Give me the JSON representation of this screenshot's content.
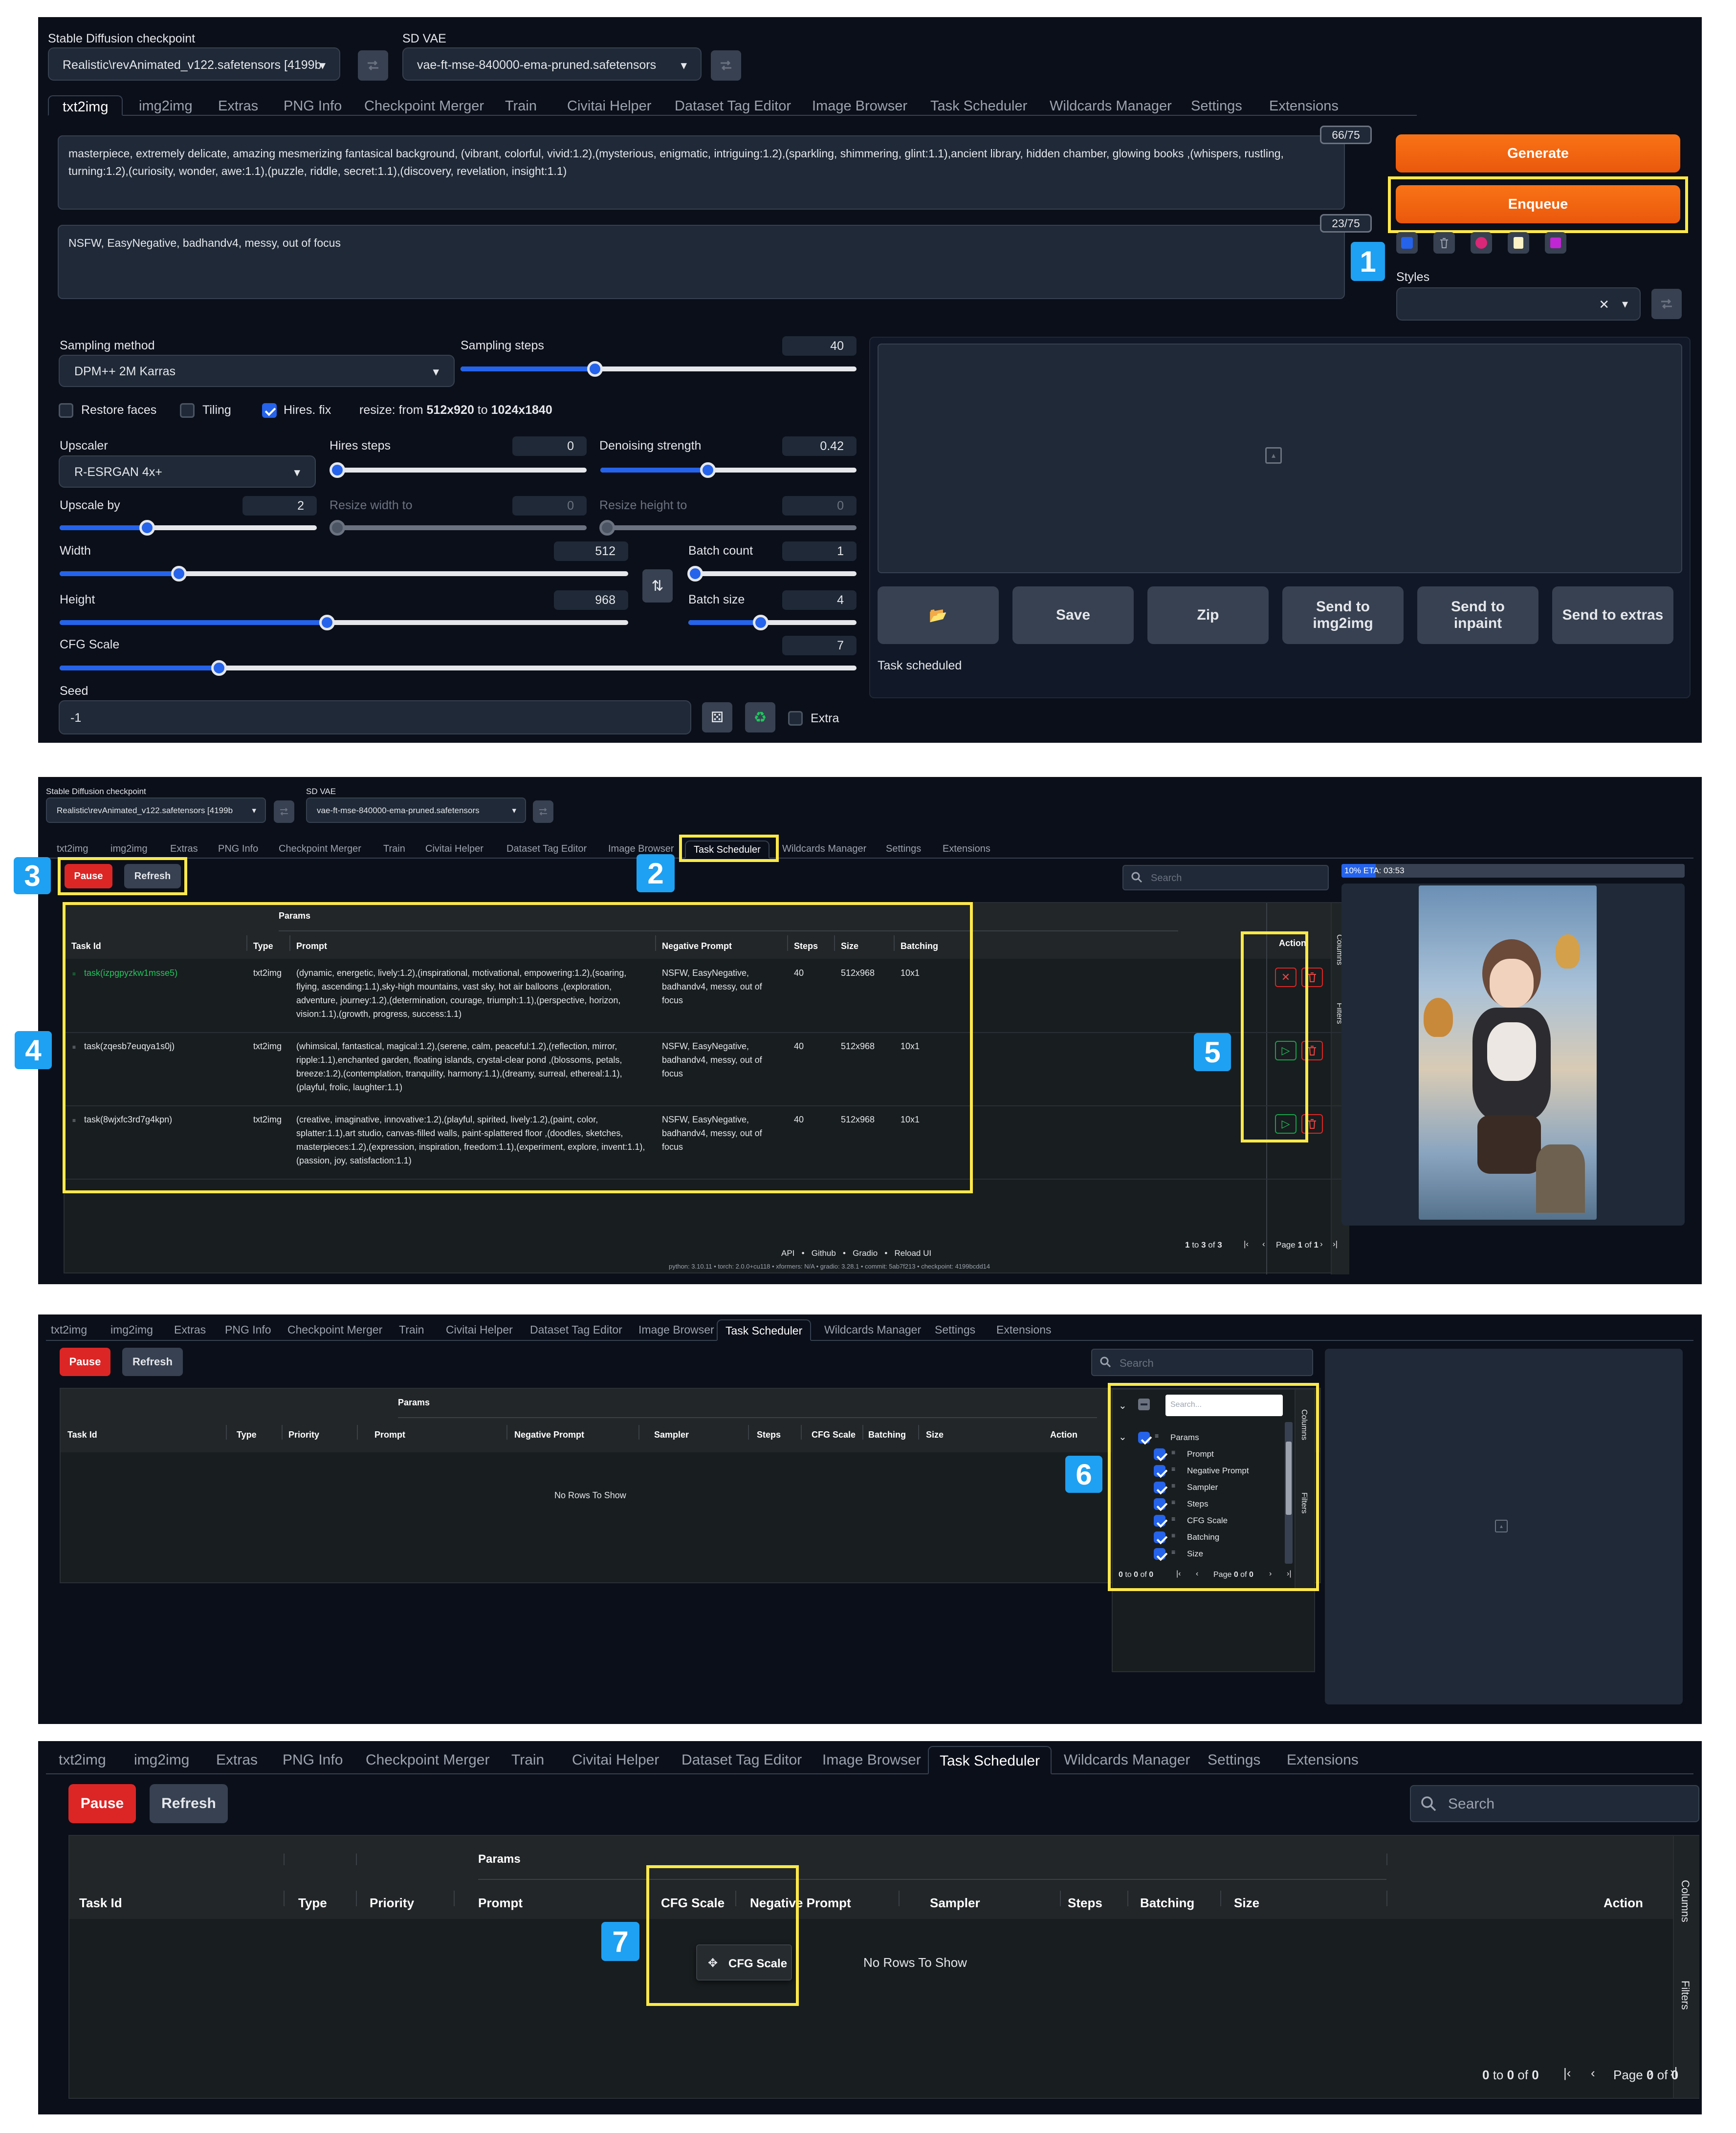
{
  "p1": {
    "ckpt_label": "Stable Diffusion checkpoint",
    "ckpt_value": "Realistic\\revAnimated_v122.safetensors [4199b",
    "vae_label": "SD VAE",
    "vae_value": "vae-ft-mse-840000-ema-pruned.safetensors",
    "tabs": [
      "txt2img",
      "img2img",
      "Extras",
      "PNG Info",
      "Checkpoint Merger",
      "Train",
      "Civitai Helper",
      "Dataset Tag Editor",
      "Image Browser",
      "Task Scheduler",
      "Wildcards Manager",
      "Settings",
      "Extensions"
    ],
    "prompt": "masterpiece, extremely delicate, amazing mesmerizing fantasical background, (vibrant, colorful, vivid:1.2),(mysterious, enigmatic, intriguing:1.2),(sparkling, shimmering, glint:1.1),ancient library, hidden chamber, glowing books ,(whispers, rustling, turning:1.2),(curiosity, wonder, awe:1.1),(puzzle, riddle, secret:1.1),(discovery, revelation, insight:1.1)",
    "prompt_count": "66/75",
    "neg_prompt": "NSFW, EasyNegative, badhandv4, messy, out of focus",
    "neg_count": "23/75",
    "generate": "Generate",
    "enqueue": "Enqueue",
    "styles_label": "Styles",
    "sampling_method_label": "Sampling method",
    "sampling_method": "DPM++ 2M Karras",
    "sampling_steps_label": "Sampling steps",
    "sampling_steps": "40",
    "restore_faces": "Restore faces",
    "tiling": "Tiling",
    "hires_fix": "Hires. fix",
    "resize_prefix": "resize: from ",
    "resize_from": "512x920",
    "resize_mid": " to ",
    "resize_to": "1024x1840",
    "upscaler_label": "Upscaler",
    "upscaler": "R-ESRGAN 4x+",
    "hires_steps_label": "Hires steps",
    "hires_steps": "0",
    "denoise_label": "Denoising strength",
    "denoise": "0.42",
    "upscale_by_label": "Upscale by",
    "upscale_by": "2",
    "resize_w_label": "Resize width to",
    "resize_w": "0",
    "resize_h_label": "Resize height to",
    "resize_h": "0",
    "width_label": "Width",
    "width": "512",
    "height_label": "Height",
    "height": "968",
    "batch_count_label": "Batch count",
    "batch_count": "1",
    "batch_size_label": "Batch size",
    "batch_size": "4",
    "cfg_label": "CFG Scale",
    "cfg": "7",
    "seed_label": "Seed",
    "seed": "-1",
    "extra": "Extra",
    "out_buttons": [
      "Save",
      "Zip",
      "Send to img2img",
      "Send to inpaint",
      "Send to extras"
    ],
    "task_scheduled": "Task scheduled",
    "badge": "1"
  },
  "p2": {
    "ckpt_label": "Stable Diffusion checkpoint",
    "ckpt_value": "Realistic\\revAnimated_v122.safetensors [4199b",
    "vae_label": "SD VAE",
    "vae_value": "vae-ft-mse-840000-ema-pruned.safetensors",
    "tabs": [
      "txt2img",
      "img2img",
      "Extras",
      "PNG Info",
      "Checkpoint Merger",
      "Train",
      "Civitai Helper",
      "Dataset Tag Editor",
      "Image Browser",
      "Task Scheduler",
      "Wildcards Manager",
      "Settings",
      "Extensions"
    ],
    "pause": "Pause",
    "refresh": "Refresh",
    "search_ph": "Search",
    "params": "Params",
    "cols": [
      "Task Id",
      "Type",
      "Prompt",
      "Negative Prompt",
      "Steps",
      "Size",
      "Batching"
    ],
    "action": "Action",
    "rows": [
      {
        "id": "task(izpgpyzkw1msse5)",
        "type": "txt2img",
        "prompt": "(dynamic, energetic, lively:1.2),(inspirational, motivational, empowering:1.2),(soaring, flying, ascending:1.1),sky-high mountains, vast sky, hot air balloons ,(exploration, adventure, journey:1.2),(determination, courage, triumph:1.1),(perspective, horizon, vision:1.1),(growth, progress, success:1.1)",
        "neg": "NSFW, EasyNegative, badhandv4, messy, out of focus",
        "steps": "40",
        "size": "512x968",
        "batching": "10x1"
      },
      {
        "id": "task(zqesb7euqya1s0j)",
        "type": "txt2img",
        "prompt": "(whimsical, fantastical, magical:1.2),(serene, calm, peaceful:1.2),(reflection, mirror, ripple:1.1),enchanted garden, floating islands, crystal-clear pond ,(blossoms, petals, breeze:1.2),(contemplation, tranquility, harmony:1.1),(dreamy, surreal, ethereal:1.1),(playful, frolic, laughter:1.1)",
        "neg": "NSFW, EasyNegative, badhandv4, messy, out of focus",
        "steps": "40",
        "size": "512x968",
        "batching": "10x1"
      },
      {
        "id": "task(8wjxfc3rd7g4kpn)",
        "type": "txt2img",
        "prompt": "(creative, imaginative, innovative:1.2),(playful, spirited, lively:1.2),(paint, color, splatter:1.1),art studio, canvas-filled walls, paint-splattered floor ,(doodles, sketches, masterpieces:1.2),(expression, inspiration, freedom:1.1),(experiment, explore, invent:1.1),(passion, joy, satisfaction:1.1)",
        "neg": "NSFW, EasyNegative, badhandv4, messy, out of focus",
        "steps": "40",
        "size": "512x968",
        "batching": "10x1"
      }
    ],
    "columns_tab": "Columns",
    "filters_tab": "Filters",
    "pager_a": "1",
    "pager_to": " to ",
    "pager_b": "3",
    "pager_of": " of ",
    "pager_c": "3",
    "page_txt": "Page ",
    "page_a": "1",
    "page_of": " of ",
    "page_b": "1",
    "progress": "10% ETA: 03:53",
    "progress_pct": 10,
    "footer_links": [
      "API",
      "Github",
      "Gradio",
      "Reload UI"
    ],
    "footer_info": "python: 3.10.11  •  torch: 2.0.0+cu118  •  xformers: N/A  •  gradio: 3.28.1  •  commit: 5ab7f213  •  checkpoint: 4199bcdd14",
    "badges": [
      "2",
      "3",
      "4",
      "5"
    ]
  },
  "p3": {
    "tabs": [
      "txt2img",
      "img2img",
      "Extras",
      "PNG Info",
      "Checkpoint Merger",
      "Train",
      "Civitai Helper",
      "Dataset Tag Editor",
      "Image Browser",
      "Task Scheduler",
      "Wildcards Manager",
      "Settings",
      "Extensions"
    ],
    "pause": "Pause",
    "refresh": "Refresh",
    "search_ph": "Search",
    "params": "Params",
    "cols": [
      "Task Id",
      "Type",
      "Priority",
      "Prompt",
      "Negative Prompt",
      "Sampler",
      "Steps",
      "CFG Scale",
      "Batching",
      "Size"
    ],
    "action": "Action",
    "no_rows": "No Rows To Show",
    "col_search_ph": "Search...",
    "col_group": "Params",
    "col_items": [
      "Prompt",
      "Negative Prompt",
      "Sampler",
      "Steps",
      "CFG Scale",
      "Batching",
      "Size"
    ],
    "columns_tab": "Columns",
    "filters_tab": "Filters",
    "pager_a": "0",
    "pager_to": " to ",
    "pager_b": "0",
    "pager_of": " of ",
    "pager_c": "0",
    "page_txt": "Page ",
    "page_a": "0",
    "page_of": " of ",
    "page_b": "0",
    "badge": "6"
  },
  "p4": {
    "tabs": [
      "txt2img",
      "img2img",
      "Extras",
      "PNG Info",
      "Checkpoint Merger",
      "Train",
      "Civitai Helper",
      "Dataset Tag Editor",
      "Image Browser",
      "Task Scheduler",
      "Wildcards Manager",
      "Settings",
      "Extensions"
    ],
    "pause": "Pause",
    "refresh": "Refresh",
    "search_ph": "Search",
    "params": "Params",
    "cols": [
      "Task Id",
      "Type",
      "Priority",
      "Prompt",
      "CFG Scale",
      "Negative Prompt",
      "Sampler",
      "Steps",
      "Batching",
      "Size"
    ],
    "action": "Action",
    "drag_label": "CFG Scale",
    "no_rows": "No Rows To Show",
    "columns_tab": "Columns",
    "filters_tab": "Filters",
    "pager_a": "0",
    "pager_to": " to ",
    "pager_b": "0",
    "pager_of": " of ",
    "pager_c": "0",
    "page_txt": "Page ",
    "page_a": "0",
    "page_of": " of ",
    "page_b": "0",
    "badge": "7"
  }
}
